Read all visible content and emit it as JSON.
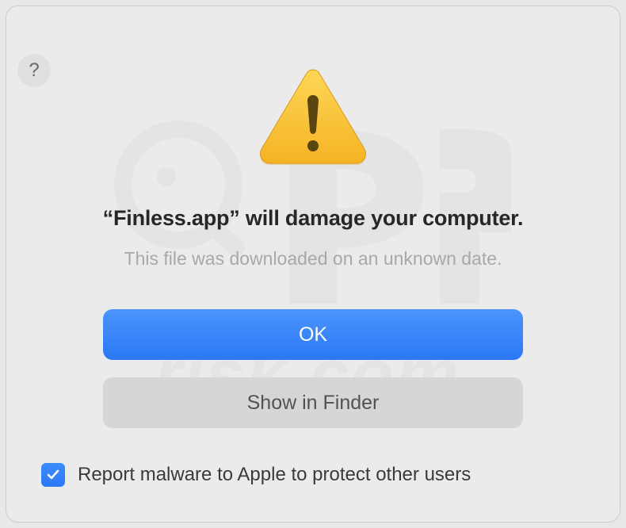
{
  "dialog": {
    "app_name": "Finless.app",
    "headline_prefix": "“",
    "headline_suffix": "” will damage your computer.",
    "headline": "“Finless.app” will damage your computer.",
    "subtext": "This file was downloaded on an unknown date.",
    "buttons": {
      "ok": "OK",
      "show_in_finder": "Show in Finder"
    },
    "checkbox": {
      "checked": true,
      "label": "Report malware to Apple to protect other users"
    },
    "help_label": "?"
  },
  "icons": {
    "warning": "warning-triangle",
    "help": "help-circle",
    "checkmark": "checkmark"
  }
}
